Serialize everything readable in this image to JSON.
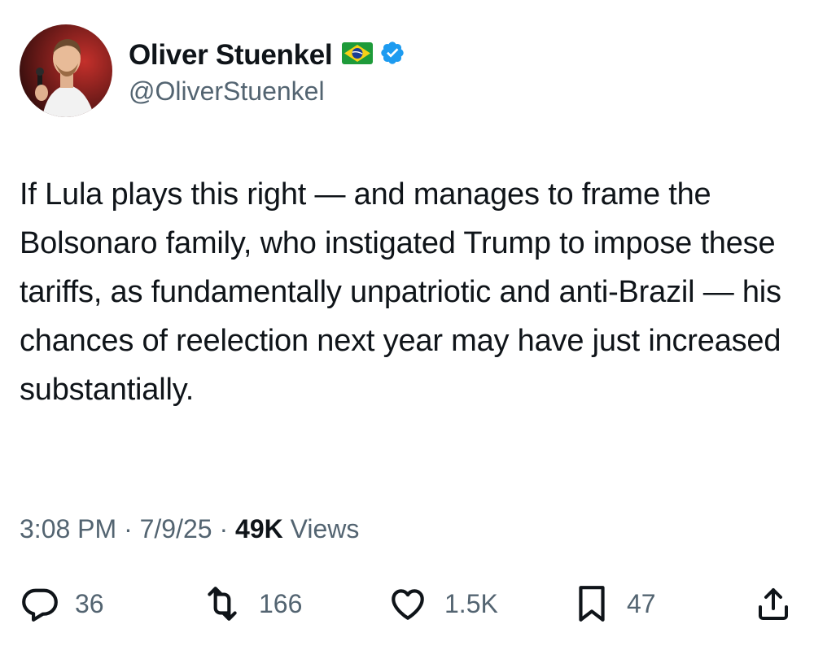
{
  "author": {
    "display_name": "Oliver Stuenkel",
    "handle": "@OliverStuenkel",
    "flag_icon": "brazil-flag-icon",
    "verified_icon": "verified-badge-icon",
    "verified_color": "#1d9bf0"
  },
  "tweet": {
    "text": "If Lula plays this right — and manages to frame the Bolsonaro family, who instigated Trump to impose these tariffs, as fundamentally unpatriotic and anti-Brazil — his chances of reelection next year may have just increased substantially."
  },
  "meta": {
    "time": "3:08 PM",
    "separator": " · ",
    "date": "7/9/25",
    "views_count": "49K",
    "views_label": " Views"
  },
  "actions": {
    "replies": {
      "icon": "reply-icon",
      "count": "36"
    },
    "retweets": {
      "icon": "retweet-icon",
      "count": "166"
    },
    "likes": {
      "icon": "heart-icon",
      "count": "1.5K"
    },
    "bookmarks": {
      "icon": "bookmark-icon",
      "count": "47"
    },
    "share": {
      "icon": "share-icon"
    }
  },
  "colors": {
    "text_primary": "#0f1419",
    "text_secondary": "#536471",
    "accent": "#1d9bf0"
  }
}
